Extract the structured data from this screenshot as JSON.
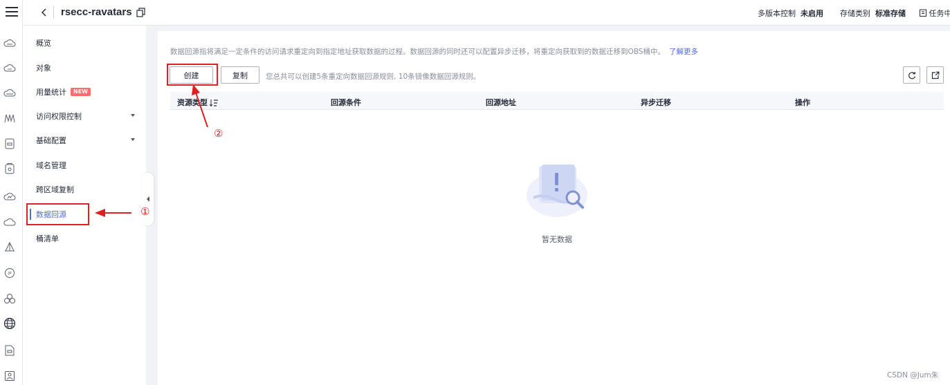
{
  "header": {
    "bucket_name": "rsecc-ravatars",
    "versioning_label": "多版本控制",
    "versioning_value": "未启用",
    "storage_class_label": "存储类别",
    "storage_class_value": "标准存储",
    "tasks_label": "任务中"
  },
  "rail_icons": [
    "menu-icon",
    "cloud-icon",
    "cloud-icon",
    "cloud-icon",
    "network-icon",
    "storage-icon",
    "storage-icon",
    "cloud-icon",
    "cloud-icon",
    "tent-icon",
    "ip-icon",
    "cluster-icon",
    "globe-icon",
    "document-icon",
    "id-badge-icon"
  ],
  "sidebar": {
    "items": [
      {
        "label": "概览"
      },
      {
        "label": "对象"
      },
      {
        "label": "用量统计",
        "badge": "NEW"
      },
      {
        "label": "访问权限控制"
      },
      {
        "label": "基础配置"
      },
      {
        "label": "域名管理"
      },
      {
        "label": "跨区域复制"
      },
      {
        "label": "数据回源"
      },
      {
        "label": "桶清单"
      }
    ]
  },
  "main": {
    "description": "数据回源指将满足一定条件的访问请求重定向到指定地址获取数据的过程。数据回源的同时还可以配置异步迁移，将重定向获取到的数据迁移到OBS桶中。",
    "learn_more": "了解更多",
    "create_button": "创建",
    "copy_button": "复制",
    "limit_note": "您总共可以创建5条重定向数据回源规则, 10条镜像数据回源规则。",
    "columns": [
      "资源类型",
      "回源条件",
      "回源地址",
      "异步迁移",
      "操作"
    ],
    "rows": [],
    "empty_text": "暂无数据"
  },
  "annotations": {
    "marker_1": "①",
    "marker_2": "②"
  },
  "watermark": "CSDN @Jum朱",
  "colors": {
    "accent": "#526ecc",
    "annotation_red": "#e02020",
    "new_badge": "#f66f6a",
    "background_gray": "#f0f2f5"
  }
}
